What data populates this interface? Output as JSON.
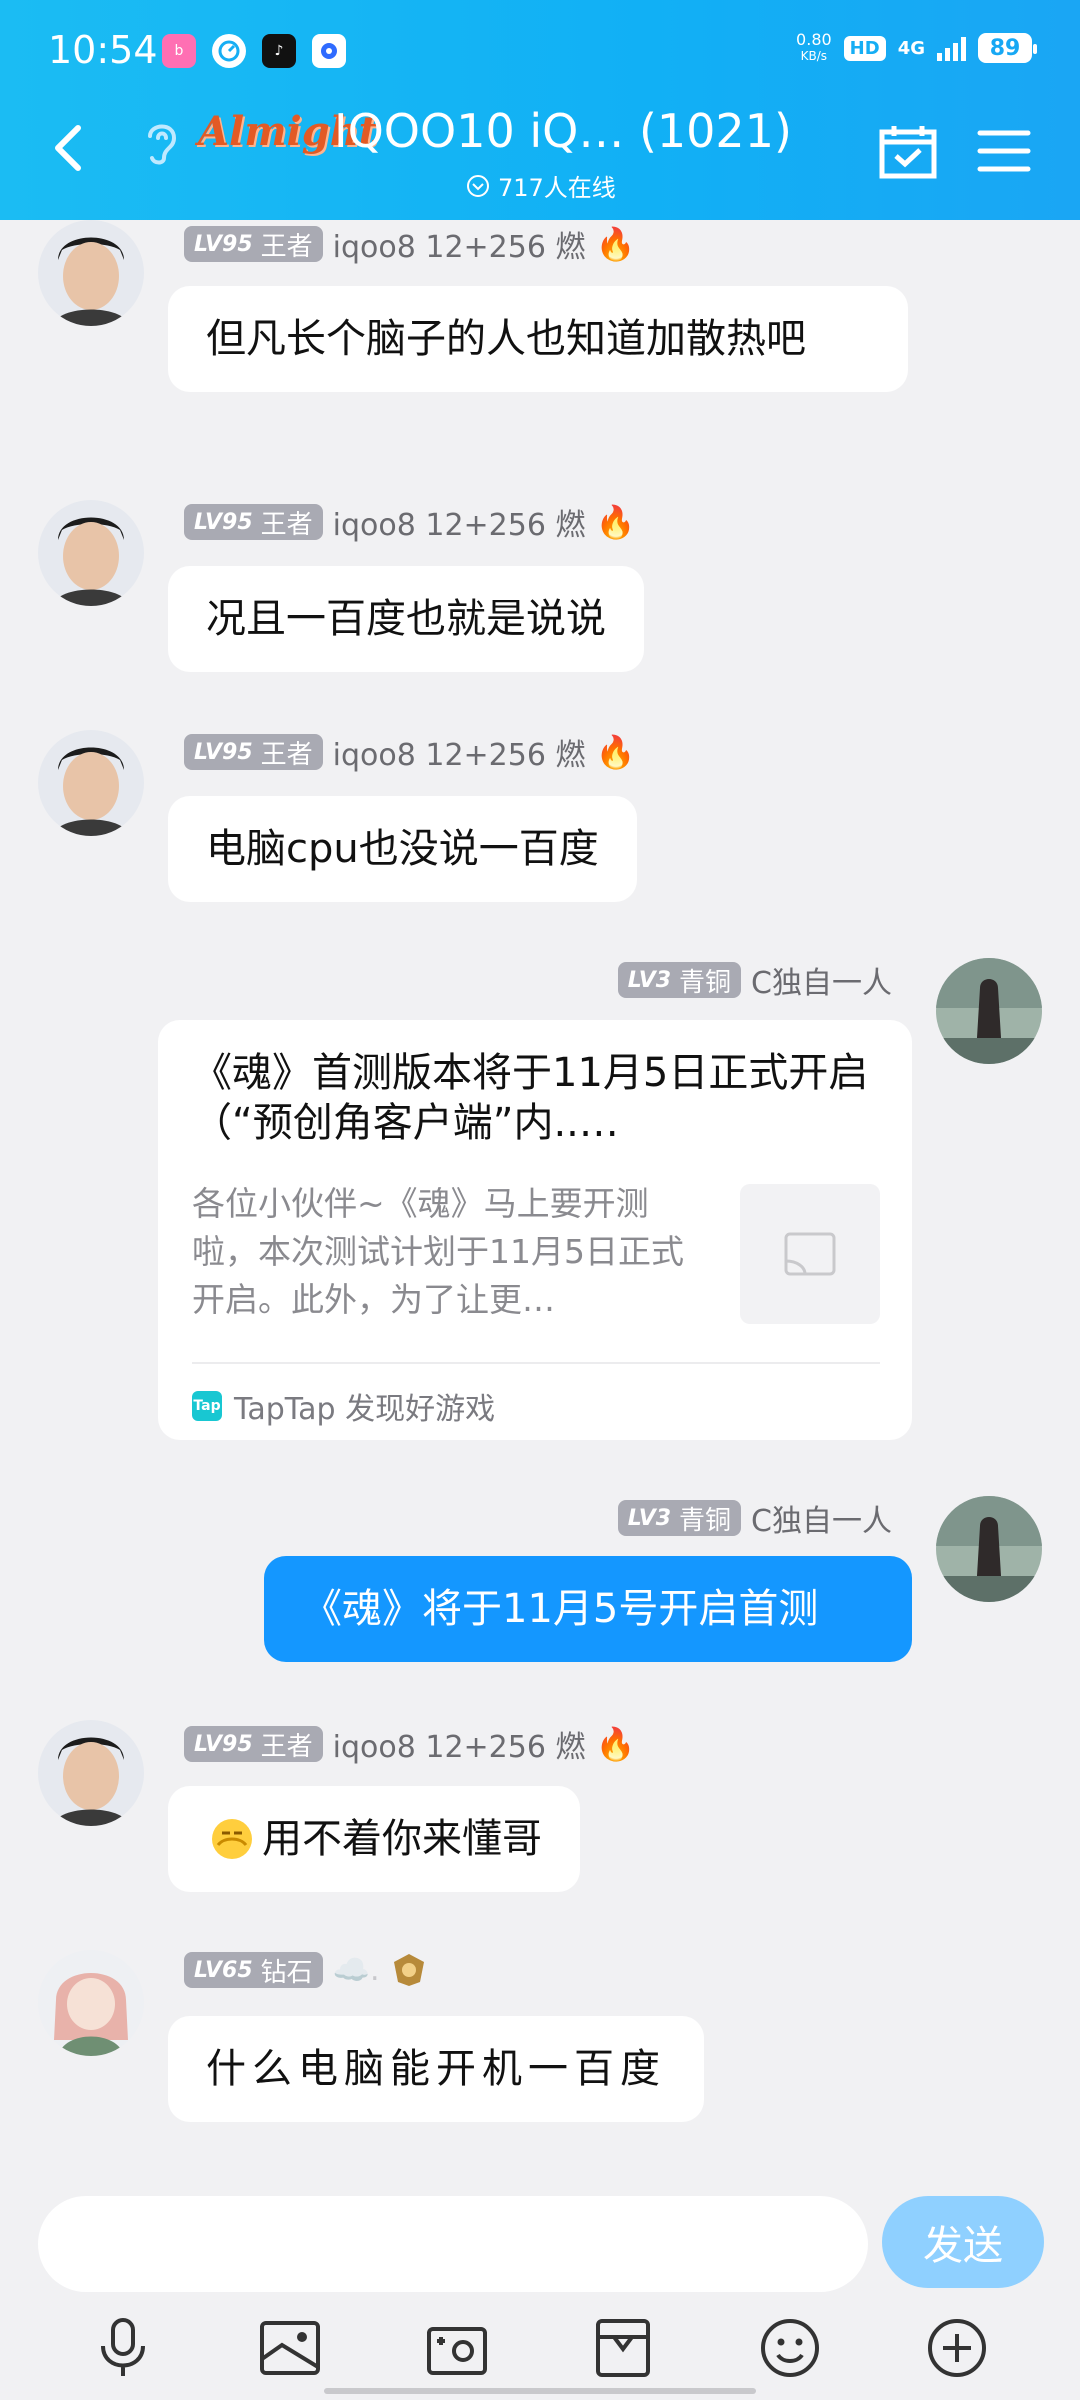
{
  "status": {
    "time": "10:54",
    "net_speed_value": "0.80",
    "net_speed_unit": "KB/s",
    "hd": "HD",
    "network": "4G",
    "battery": "89"
  },
  "header": {
    "logo_text": "Almight",
    "title": "IQOO10 iQ… (1021)",
    "online": "717人在线"
  },
  "messages": [
    {
      "level": "LV95",
      "rank": "王者",
      "name": "iqoo8 12+256 燃",
      "text": "但凡长个脑子的人也知道加散热吧"
    },
    {
      "level": "LV95",
      "rank": "王者",
      "name": "iqoo8 12+256 燃",
      "text": "况且一百度也就是说说"
    },
    {
      "level": "LV95",
      "rank": "王者",
      "name": "iqoo8 12+256 燃",
      "text": "电脑cpu也没说一百度"
    },
    {
      "level": "LV3",
      "rank": "青铜",
      "name": "C独自一人"
    },
    {
      "level": "LV3",
      "rank": "青铜",
      "name": "C独自一人",
      "text": "《魂》将于11月5号开启首测"
    },
    {
      "level": "LV95",
      "rank": "王者",
      "name": "iqoo8 12+256 燃",
      "text": "用不着你来懂哥"
    },
    {
      "level": "LV65",
      "rank": "钻石",
      "name": "☁️.",
      "text": "什么电脑能开机一百度"
    }
  ],
  "share_card": {
    "title": "《魂》首测版本将于11月5日正式开启（“预创角客户端”内..…",
    "description": "各位小伙伴~《魂》马上要开测啦，本次测试计划于11月5日正式开启。此外，为了让更…",
    "source": "TapTap 发现好游戏",
    "source_logo": "Tap"
  },
  "input": {
    "placeholder": "",
    "send_label": "发送"
  },
  "icons": [
    "back-icon",
    "ear-icon",
    "calendar-check-icon",
    "menu-icon",
    "microphone-icon",
    "image-icon",
    "camera-icon",
    "gift-box-icon",
    "emoji-icon",
    "plus-icon",
    "fire-icon",
    "image-placeholder-icon"
  ],
  "colors": {
    "header": "#15b4f4",
    "bubble_blue": "#1497ff",
    "send_button": "#8fd0ff",
    "background": "#f1f1f3"
  }
}
